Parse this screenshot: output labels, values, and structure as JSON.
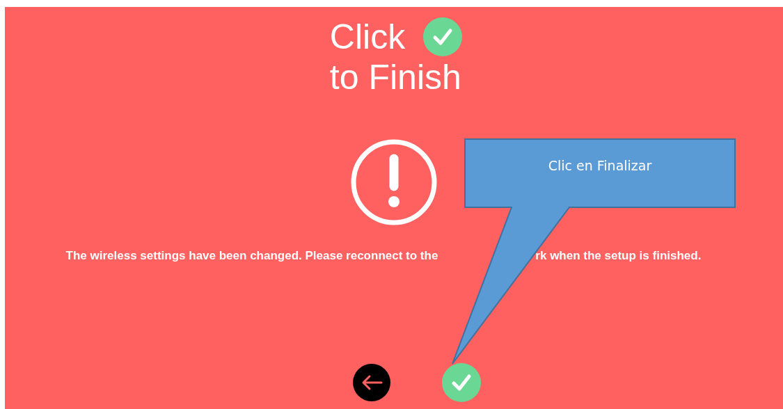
{
  "title": {
    "line_1": "Click",
    "line_2": "to Finish"
  },
  "message_parts": [
    "The wireless settings have been changed. Please reconnect to the",
    "rk when the setup is finished."
  ],
  "callout": {
    "text": "Clic en Finalizar"
  },
  "buttons": [
    {
      "kind": "back"
    },
    {
      "kind": "finish"
    }
  ]
}
